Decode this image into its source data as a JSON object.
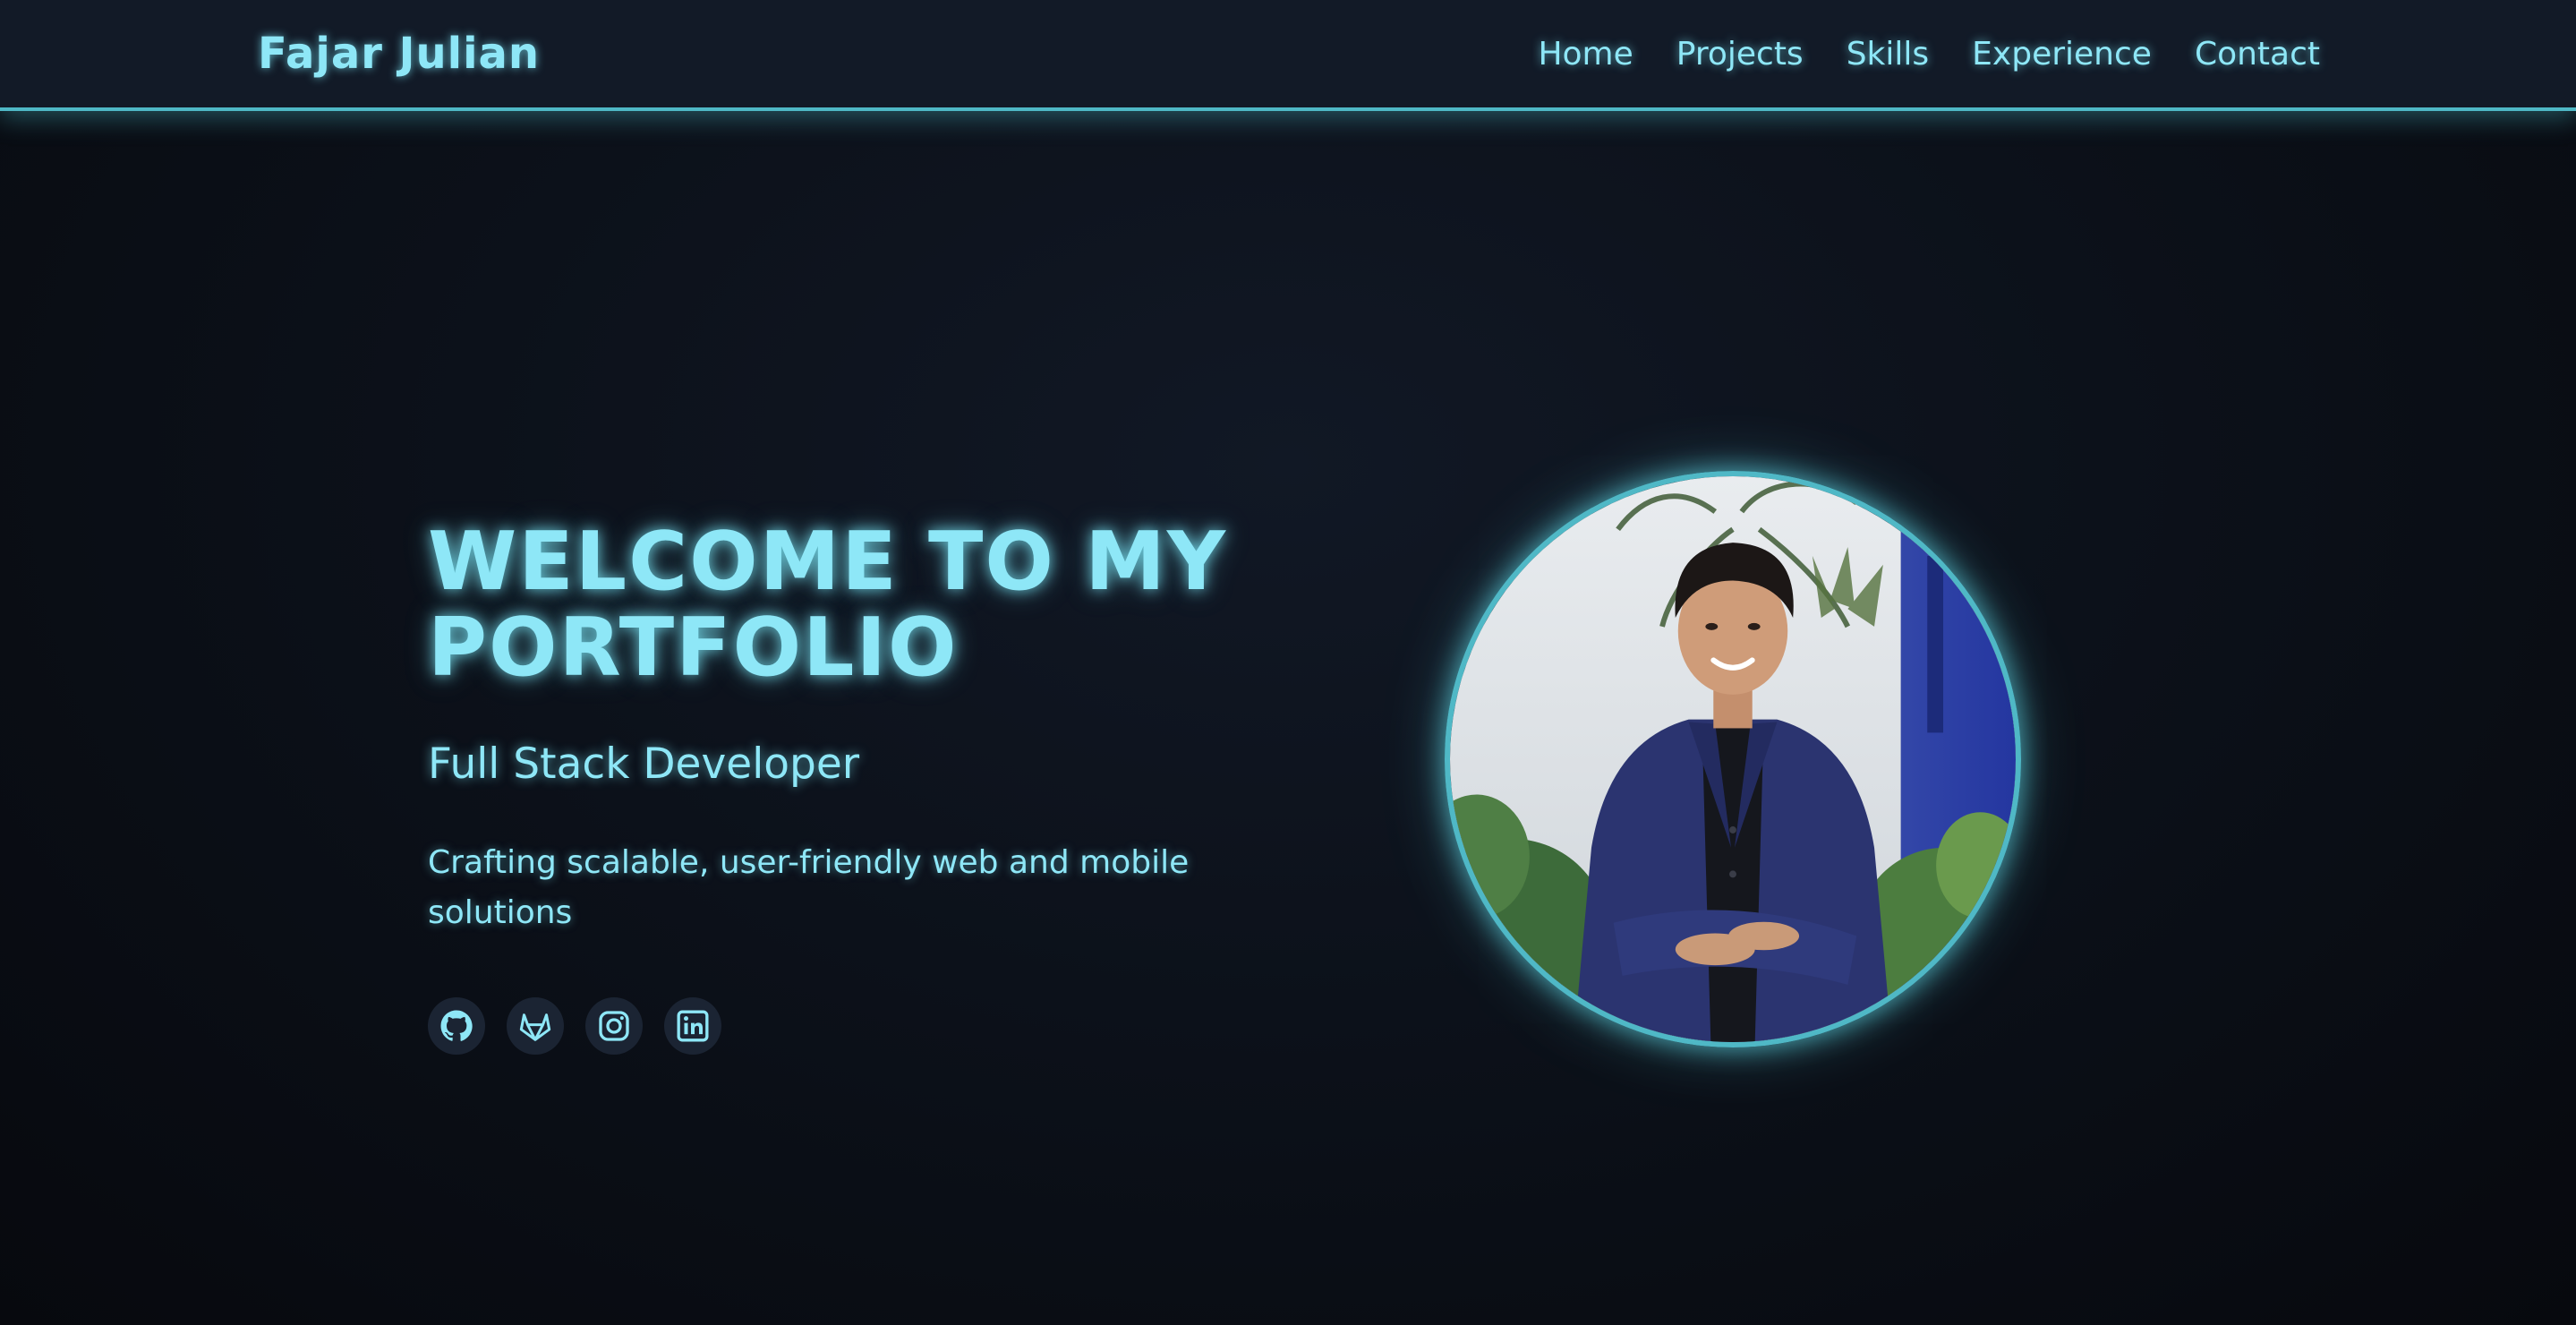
{
  "brand": "Fajar Julian",
  "nav": {
    "items": [
      {
        "label": "Home"
      },
      {
        "label": "Projects"
      },
      {
        "label": "Skills"
      },
      {
        "label": "Experience"
      },
      {
        "label": "Contact"
      }
    ]
  },
  "hero": {
    "title": "WELCOME TO MY PORTFOLIO",
    "role": "Full Stack Developer",
    "description": "Crafting scalable, user-friendly web and mobile solutions"
  },
  "socials": [
    {
      "icon": "github-icon"
    },
    {
      "icon": "gitlab-icon"
    },
    {
      "icon": "instagram-icon"
    },
    {
      "icon": "linkedin-icon"
    }
  ],
  "colors": {
    "accent": "#8ee7f7",
    "border": "#4fb8c6",
    "nav_bg": "#121a27",
    "page_bg": "#0b0f17",
    "icon_bg": "#1b2433"
  }
}
